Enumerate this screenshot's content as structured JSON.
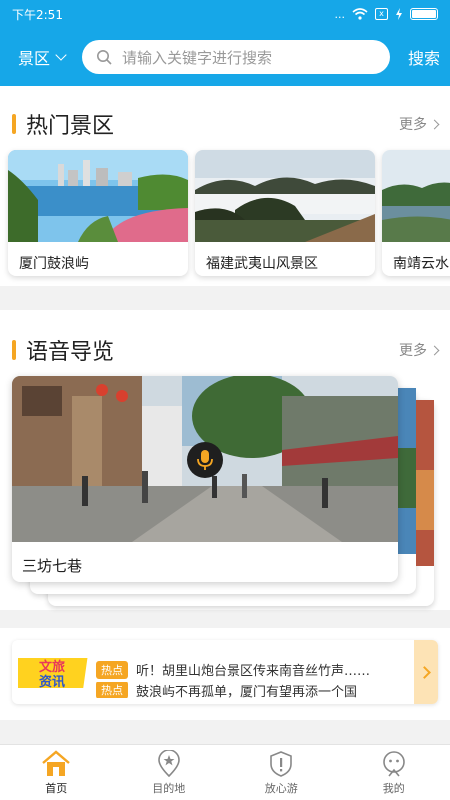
{
  "status": {
    "time": "下午2:51",
    "sim": "x",
    "dots": "..."
  },
  "header": {
    "region": "景区",
    "search_placeholder": "请输入关键字进行搜索",
    "search_button": "搜索"
  },
  "hot": {
    "title": "热门景区",
    "more": "更多",
    "cards": [
      {
        "label": "厦门鼓浪屿"
      },
      {
        "label": "福建武夷山风景区"
      },
      {
        "label": "南靖云水"
      }
    ]
  },
  "voice": {
    "title": "语音导览",
    "more": "更多",
    "card_label": "三坊七巷"
  },
  "news": {
    "logo_line1": "文旅",
    "logo_line2": "资讯",
    "items": [
      {
        "tag": "热点",
        "text": "听！胡里山炮台景区传来南音丝竹声……"
      },
      {
        "tag": "热点",
        "text": "鼓浪屿不再孤单，厦门有望再添一个国"
      }
    ]
  },
  "tabs": [
    {
      "label": "首页",
      "icon": "home-icon",
      "active": true
    },
    {
      "label": "目的地",
      "icon": "location-pin-icon",
      "active": false
    },
    {
      "label": "放心游",
      "icon": "shield-icon",
      "active": false
    },
    {
      "label": "我的",
      "icon": "profile-icon",
      "active": false
    }
  ],
  "colors": {
    "primary": "#16a7e8",
    "accent": "#f5a623"
  }
}
